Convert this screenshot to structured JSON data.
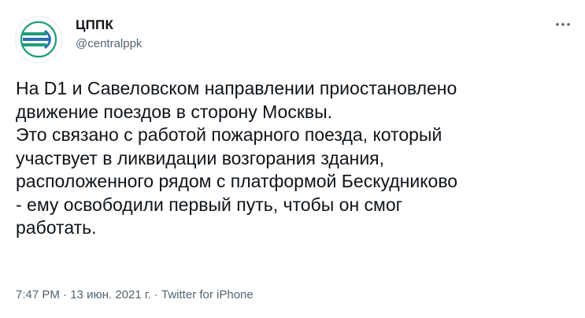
{
  "account": {
    "name": "ЦППК",
    "handle": "@centralppk",
    "avatar_icon": "cppk-logo-icon",
    "brand_color": "#1f9e7a"
  },
  "more_icon": "more-options-icon",
  "tweet": {
    "lines": [
      "На D1 и Савеловском направлении приостановлено",
      "движение поездов в сторону Москвы.",
      "Это связано с работой пожарного поезда, который",
      "участвует в ликвидации возгорания здания,",
      "расположенного рядом с платформой Бескудниково",
      "- ему освободили первый путь, чтобы он смог",
      "работать."
    ]
  },
  "meta": {
    "time": "7:47 PM",
    "sep1": " · ",
    "date": "13 июн. 2021 г.",
    "sep2": " · ",
    "source": "Twitter for iPhone"
  }
}
